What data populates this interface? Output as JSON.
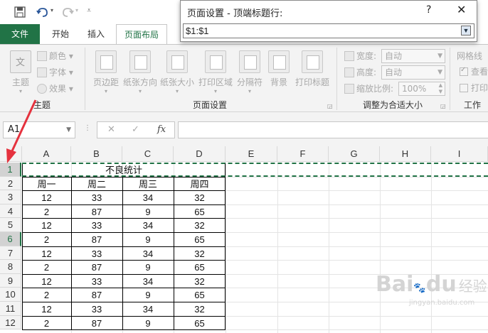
{
  "qat": {
    "save_icon": "save-icon",
    "undo_icon": "undo-icon",
    "redo_icon": "redo-icon",
    "customize_icon": "customize-icon"
  },
  "tabs": {
    "file": "文件",
    "home": "开始",
    "insert": "插入",
    "page_layout": "页面布局"
  },
  "ribbon": {
    "theme": {
      "themes": "主题",
      "theme_icon_text": "文",
      "colors": "颜色",
      "fonts": "字体",
      "effects": "效果",
      "group": "主题"
    },
    "page_setup": {
      "margins": "页边距",
      "orientation": "纸张方向",
      "size": "纸张大小",
      "print_area": "打印区域",
      "breaks": "分隔符",
      "background": "背景",
      "print_titles": "打印标题",
      "group": "页面设置"
    },
    "scale": {
      "width_label": "宽度:",
      "width_value": "自动",
      "height_label": "高度:",
      "height_value": "自动",
      "scale_label": "缩放比例:",
      "scale_value": "100%",
      "group": "调整为合适大小"
    },
    "sheet_options": {
      "gridlines": "网格线",
      "view": "查看",
      "print": "打印",
      "group": "工作"
    }
  },
  "dialog": {
    "title": "页面设置 - 顶端标题行:",
    "help": "?",
    "close": "✕",
    "value": "$1:$1"
  },
  "formula_bar": {
    "name_box": "A1",
    "cancel": "✕",
    "enter": "✓",
    "fx": "fx",
    "content": ""
  },
  "sheet": {
    "columns": [
      "A",
      "B",
      "C",
      "D",
      "E",
      "F",
      "G",
      "H",
      "I"
    ],
    "rows": [
      "1",
      "2",
      "3",
      "4",
      "5",
      "6",
      "7",
      "8",
      "9",
      "10",
      "11",
      "12"
    ],
    "title": "不良统计",
    "headers": [
      "周一",
      "周二",
      "周三",
      "周四"
    ],
    "data": [
      [
        "12",
        "33",
        "34",
        "32"
      ],
      [
        "2",
        "87",
        "9",
        "65"
      ],
      [
        "12",
        "33",
        "34",
        "32"
      ],
      [
        "2",
        "87",
        "9",
        "65"
      ],
      [
        "12",
        "33",
        "34",
        "32"
      ],
      [
        "2",
        "87",
        "9",
        "65"
      ],
      [
        "12",
        "33",
        "34",
        "32"
      ],
      [
        "2",
        "87",
        "9",
        "65"
      ],
      [
        "12",
        "33",
        "34",
        "32"
      ],
      [
        "2",
        "87",
        "9",
        "65"
      ]
    ],
    "selected_rows": [
      "1",
      "6"
    ]
  },
  "watermark": {
    "logo": "Bai",
    "paw": "du",
    "brand": "经验",
    "url": "jingyan.baidu.com"
  },
  "colors": {
    "accent": "#217346",
    "arrow": "#e5323e"
  }
}
